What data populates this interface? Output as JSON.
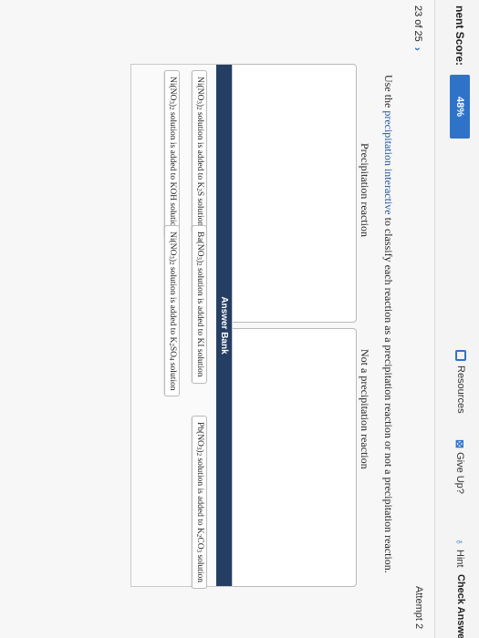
{
  "header": {
    "score_label": "nent Score:",
    "score_value": "48%",
    "resources_label": "Resources",
    "give_up_label": "Give Up?",
    "hint_label": "Hint",
    "check_answer_label": "Check Answer",
    "attempt_label": "Attempt 2"
  },
  "nav": {
    "question_position": "23 of 25",
    "next_chevron": "›"
  },
  "question": {
    "prompt_before": "Use the ",
    "prompt_link": "precipitation interactive",
    "prompt_after": " to classify each reaction as a precipitation reaction or not a precipitation reaction."
  },
  "bins": {
    "left_title": "Precipitation reaction",
    "right_title": "Not a precipitation reaction"
  },
  "answer_bank": {
    "title": "Answer Bank",
    "items": [
      [
        "Ni(NO",
        "3",
        ")",
        "2",
        " solution is added to K",
        "2",
        "S solution"
      ],
      [
        "Ba(NO",
        "3",
        ")",
        "2",
        " solution is added to KI solution"
      ],
      [
        "Pb(NO",
        "3",
        ")",
        "2",
        " solution is added to K",
        "2",
        "CO",
        "3",
        " solution"
      ],
      [
        "Ni(NO",
        "3",
        ")",
        "2",
        " solution is added to KOH solution"
      ],
      [
        "Ni(NO",
        "3",
        ")",
        "2",
        " solution is added to K",
        "2",
        "SO",
        "4",
        " solution"
      ]
    ]
  },
  "colors": {
    "accent": "#2f73c9",
    "bank_header": "#253e63",
    "link": "#1a4f9c"
  },
  "icons": [
    "document-icon",
    "give-up-icon",
    "lightbulb-icon",
    "chevron-right-icon"
  ]
}
